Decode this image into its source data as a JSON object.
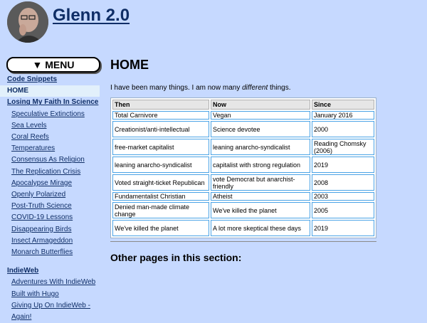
{
  "site": {
    "title": "Glenn 2.0",
    "avatar_icon": "portrait-photo"
  },
  "menu": {
    "label": "▼ MENU"
  },
  "sidebar": {
    "items": [
      {
        "label": "Code Snippets",
        "type": "sec"
      },
      {
        "label": "HOME",
        "type": "sec",
        "active": true
      },
      {
        "label": "Losing My Faith In Science",
        "type": "sec"
      },
      {
        "label": "Speculative Extinctions",
        "type": "sub"
      },
      {
        "label": "Sea Levels",
        "type": "sub"
      },
      {
        "label": "Coral Reefs",
        "type": "sub"
      },
      {
        "label": "Temperatures",
        "type": "sub"
      },
      {
        "label": "Consensus As Religion",
        "type": "sub"
      },
      {
        "label": "The Replication Crisis",
        "type": "sub"
      },
      {
        "label": "Apocalypse Mirage",
        "type": "sub"
      },
      {
        "label": "Openly Polarized",
        "type": "sub"
      },
      {
        "label": "Post-Truth Science",
        "type": "sub"
      },
      {
        "label": "COVID-19 Lessons",
        "type": "sub"
      },
      {
        "label": "Disappearing Birds",
        "type": "sub"
      },
      {
        "label": "Insect Armageddon",
        "type": "sub"
      },
      {
        "label": "Monarch Butterflies",
        "type": "sub"
      },
      {
        "label": "IndieWeb",
        "type": "sec",
        "gap": true
      },
      {
        "label": "Adventures With IndieWeb",
        "type": "sub"
      },
      {
        "label": "Built with Hugo",
        "type": "sub"
      },
      {
        "label": "Giving Up On IndieWeb -",
        "type": "sub"
      },
      {
        "label": "Again!",
        "type": "sub"
      }
    ]
  },
  "main": {
    "title": "HOME",
    "intro_before": "I have been many things. I am now many ",
    "intro_em": "different",
    "intro_after": " things.",
    "table": {
      "headers": [
        "Then",
        "Now",
        "Since"
      ],
      "rows": [
        [
          "Total Carnivore",
          "Vegan",
          "January 2016"
        ],
        [
          "Creationist/anti-intellectual",
          "Science devotee",
          "2000"
        ],
        [
          "free-market capitalist",
          "leaning anarcho-syndicalist",
          "Reading Chomsky (2006)"
        ],
        [
          "leaning anarcho-syndicalist",
          "capitalist with strong regulation",
          "2019"
        ],
        [
          "Voted straight-ticket Republican",
          "vote Democrat but anarchist-friendly",
          "2008"
        ],
        [
          "Fundamentalist Christian",
          "Atheist",
          "2003"
        ],
        [
          "Denied man-made climate change",
          "We've killed the planet",
          "2005"
        ],
        [
          "We've killed the planet",
          "A lot more skeptical these days",
          "2019"
        ]
      ]
    },
    "other_heading": "Other pages in this section:"
  }
}
